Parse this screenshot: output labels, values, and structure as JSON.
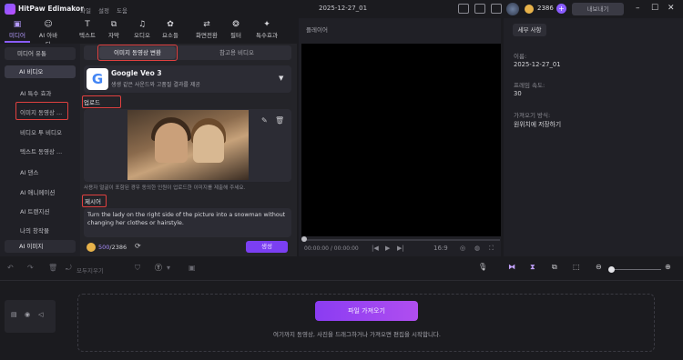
{
  "app": {
    "name": "HitPaw Edimakor",
    "menus": [
      "파일",
      "설정",
      "도움"
    ],
    "date_title": "2025-12-27_01",
    "credits": "2386",
    "export_label": "내보내기",
    "plus": "+"
  },
  "toolbar": {
    "items": [
      {
        "label": "미디어",
        "icon": "media-icon",
        "glyph": "▣"
      },
      {
        "label": "AI 아바타",
        "icon": "avatar-icon",
        "glyph": "☺"
      },
      {
        "label": "텍스트",
        "icon": "text-icon",
        "glyph": "T"
      },
      {
        "label": "자막",
        "icon": "subtitle-icon",
        "glyph": "⧉"
      },
      {
        "label": "오디오",
        "icon": "music-icon",
        "glyph": "♫"
      },
      {
        "label": "요소들",
        "icon": "elements-icon",
        "glyph": "✿"
      },
      {
        "label": "화면전환",
        "icon": "transition-icon",
        "glyph": "⇄"
      },
      {
        "label": "필터",
        "icon": "filter-icon",
        "glyph": "❂"
      },
      {
        "label": "특수효과",
        "icon": "effects-icon",
        "glyph": "✦"
      }
    ]
  },
  "leftnav": {
    "top": "미디어 유통",
    "selected": "AI 비디오",
    "items": [
      "AI 특수 효과",
      "이미지 동영상 ...",
      "비디오 투 비디오",
      "텍스트 동영상 ...",
      "AI 댄스",
      "AI 애니메이션",
      "AI 트랜지션",
      "나의 창작물"
    ],
    "bottom": "AI 이미지"
  },
  "panel": {
    "tab_active": "이미지 동영상 변환",
    "tab_other": "참고용 비디오",
    "model_name": "Google Veo 3",
    "model_desc": "생생 같은 사운드와 고품질 결과를 제공",
    "upload_label": "업로드",
    "hint": "사용자 얼굴이 포함된 경우 동의한 인원이 업로드한 이미지를 제출해 주세요.",
    "prompt_label": "제시어",
    "prompt_text": "Turn the lady on the right side of the picture into a snowman without changing her clothes or hairstyle.",
    "credits_used": "500",
    "credits_total": "/2386",
    "generate": "생성"
  },
  "player": {
    "label": "플레이어",
    "time": "00:00:00 / 00:00:00",
    "ratio": "16:9"
  },
  "details": {
    "tab": "세부 사항",
    "name_label": "이름:",
    "name_value": "2025-12-27_01",
    "fps_label": "프레임 속도:",
    "fps_value": "30",
    "save_label": "가져오기 방식:",
    "save_value": "원위치에 저장하기"
  },
  "timeline": {
    "clear": "모두지우기",
    "import": "파일 가져오기",
    "drop_hint": "여기까지 동영상, 사진을 드래그하거나 가져오면 편집을 시작합니다."
  }
}
